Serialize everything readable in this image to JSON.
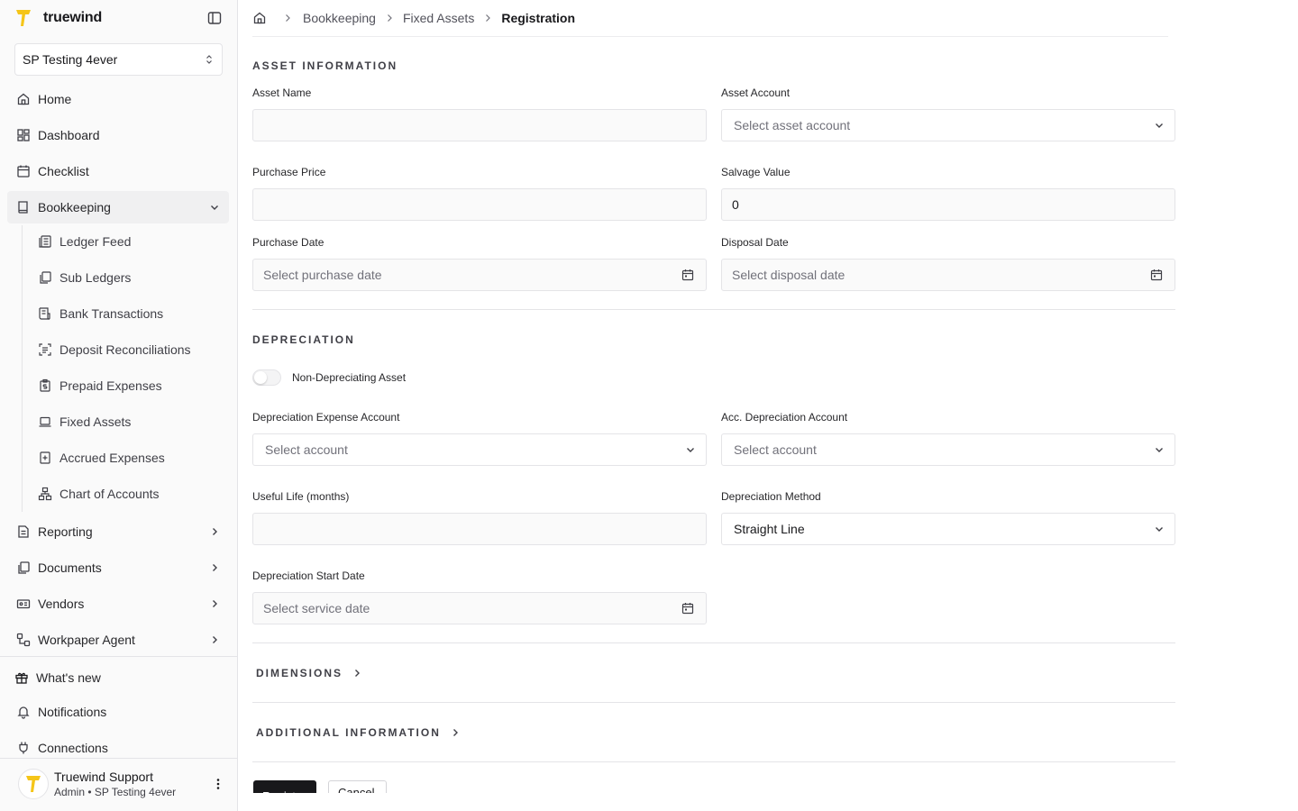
{
  "brand": {
    "name": "truewind",
    "accent": "#F5C518"
  },
  "org": {
    "selected": "SP Testing 4ever"
  },
  "nav": {
    "home": "Home",
    "dashboard": "Dashboard",
    "checklist": "Checklist",
    "bookkeeping": "Bookkeeping",
    "sub": {
      "ledger_feed": "Ledger Feed",
      "sub_ledgers": "Sub Ledgers",
      "bank_transactions": "Bank Transactions",
      "deposit_reconciliations": "Deposit Reconciliations",
      "prepaid_expenses": "Prepaid Expenses",
      "fixed_assets": "Fixed Assets",
      "accrued_expenses": "Accrued Expenses",
      "chart_of_accounts": "Chart of Accounts"
    },
    "reporting": "Reporting",
    "documents": "Documents",
    "vendors": "Vendors",
    "workpaper_agent": "Workpaper Agent",
    "whats_new": "What's new",
    "notifications": "Notifications",
    "connections": "Connections"
  },
  "user": {
    "name": "Truewind Support",
    "role": "Admin • SP Testing 4ever"
  },
  "breadcrumb": [
    "Bookkeeping",
    "Fixed Assets",
    "Registration"
  ],
  "asset_info": {
    "title": "ASSET INFORMATION",
    "asset_name_label": "Asset Name",
    "asset_name_value": "",
    "asset_account_label": "Asset Account",
    "asset_account_placeholder": "Select asset account",
    "purchase_price_label": "Purchase Price",
    "purchase_price_value": "",
    "salvage_value_label": "Salvage Value",
    "salvage_value_value": "0",
    "purchase_date_label": "Purchase Date",
    "purchase_date_placeholder": "Select purchase date",
    "disposal_date_label": "Disposal Date",
    "disposal_date_placeholder": "Select disposal date"
  },
  "depreciation": {
    "title": "DEPRECIATION",
    "toggle_label": "Non-Depreciating Asset",
    "expense_account_label": "Depreciation Expense Account",
    "expense_account_placeholder": "Select account",
    "acc_account_label": "Acc. Depreciation Account",
    "acc_account_placeholder": "Select account",
    "useful_life_label": "Useful Life (months)",
    "useful_life_value": "",
    "method_label": "Depreciation Method",
    "method_value": "Straight Line",
    "start_date_label": "Depreciation Start Date",
    "start_date_placeholder": "Select service date"
  },
  "sections": {
    "dimensions": "DIMENSIONS",
    "additional": "ADDITIONAL INFORMATION"
  },
  "buttons": {
    "register": "Register",
    "cancel": "Cancel"
  }
}
